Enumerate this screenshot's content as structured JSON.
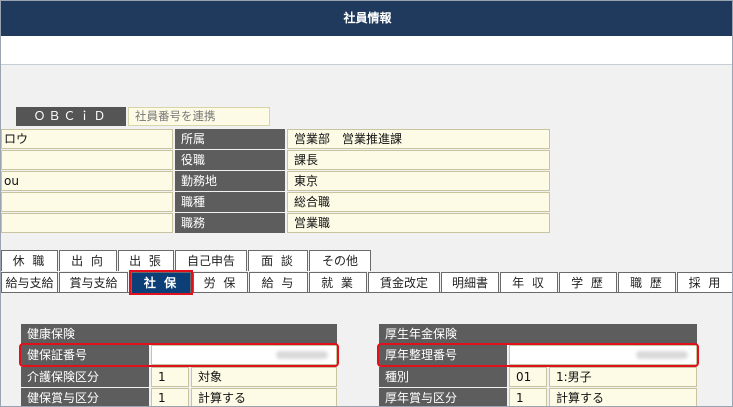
{
  "window": {
    "title": "社員情報"
  },
  "obc": {
    "button_label": "ＯＢＣｉＤ",
    "link_placeholder": "社員番号を連携"
  },
  "left_fields": [
    "ロウ",
    "",
    "ou",
    "",
    ""
  ],
  "profile": [
    {
      "label": "所属",
      "value": "営業部　営業推進課"
    },
    {
      "label": "役職",
      "value": "課長"
    },
    {
      "label": "勤務地",
      "value": "東京"
    },
    {
      "label": "職種",
      "value": "総合職"
    },
    {
      "label": "職務",
      "value": "営業職"
    }
  ],
  "tabs_row1": [
    "休 職",
    "出 向",
    "出 張",
    "自己申告",
    "面 談",
    "その他"
  ],
  "tabs_row2": [
    "給与支給",
    "賞与支給",
    "社 保",
    "労 保",
    "給 与",
    "就 業",
    "賃金改定",
    "明細書",
    "年 収",
    "学 歴",
    "職 歴",
    "採 用"
  ],
  "active_tab": "社 保",
  "health": {
    "header": "健康保険",
    "rows": [
      {
        "label": "健保証番号",
        "code": "",
        "value": ""
      },
      {
        "label": "介護保険区分",
        "code": "1",
        "value": "対象"
      },
      {
        "label": "健保賞与区分",
        "code": "1",
        "value": "計算する"
      }
    ]
  },
  "pension": {
    "header": "厚生年金保険",
    "rows": [
      {
        "label": "厚年整理番号",
        "code": "",
        "value": ""
      },
      {
        "label": "種別",
        "code": "01",
        "value": "1:男子"
      },
      {
        "label": "厚年賞与区分",
        "code": "1",
        "value": "計算する"
      }
    ]
  },
  "colors": {
    "titlebar": "#1f3a5c",
    "active_tab": "#0c3f78",
    "highlight": "#e0101c",
    "label_bg": "#5d5d5d",
    "value_bg": "#fdfbe6"
  }
}
